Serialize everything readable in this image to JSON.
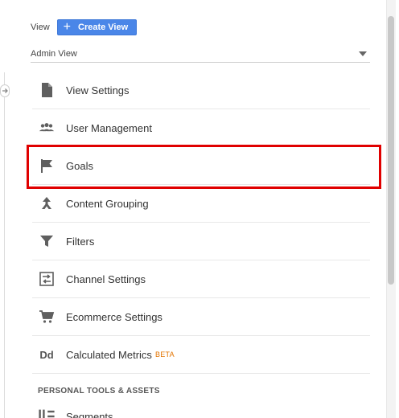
{
  "header": {
    "view_label": "View",
    "create_view_label": "Create View",
    "selected_view": "Admin View"
  },
  "menu": {
    "items": [
      {
        "label": "View Settings",
        "icon": "document-icon"
      },
      {
        "label": "User Management",
        "icon": "users-icon"
      },
      {
        "label": "Goals",
        "icon": "flag-icon"
      },
      {
        "label": "Content Grouping",
        "icon": "content-grouping-icon"
      },
      {
        "label": "Filters",
        "icon": "filter-icon"
      },
      {
        "label": "Channel Settings",
        "icon": "channel-settings-icon"
      },
      {
        "label": "Ecommerce Settings",
        "icon": "cart-icon"
      },
      {
        "label": "Calculated Metrics",
        "icon": "dd-icon",
        "icon_text": "Dd",
        "badge": "BETA"
      }
    ]
  },
  "personal_section": {
    "title": "PERSONAL TOOLS & ASSETS",
    "items": [
      {
        "label": "Segments",
        "icon": "segments-icon"
      }
    ]
  },
  "colors": {
    "accent": "#4a86e8",
    "highlight": "#e00000",
    "beta": "#e37400"
  }
}
